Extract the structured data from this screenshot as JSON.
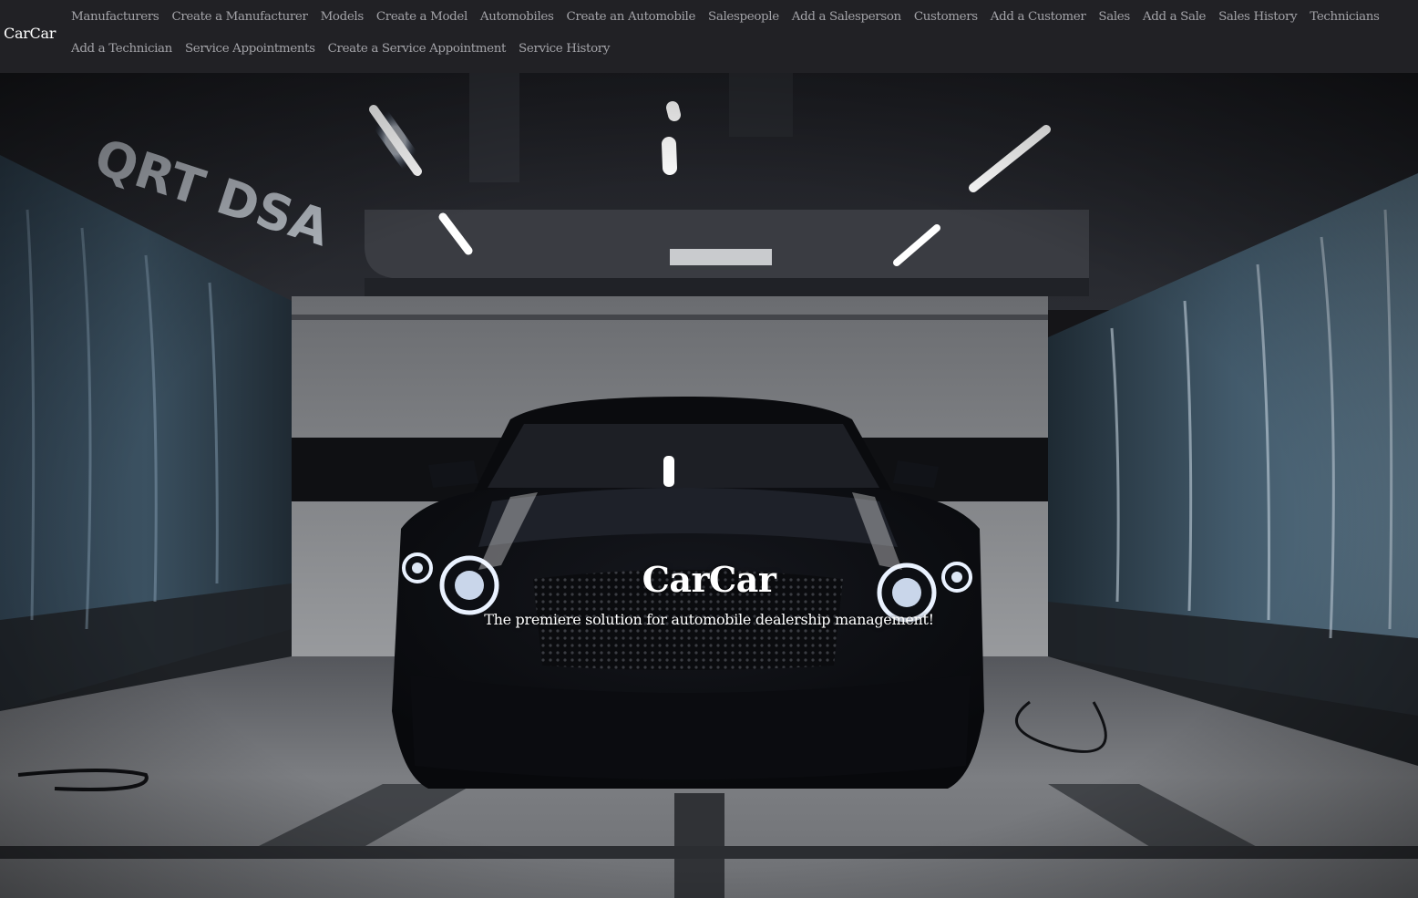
{
  "navbar": {
    "brand": "CarCar",
    "links": [
      "Manufacturers",
      "Create a Manufacturer",
      "Models",
      "Create a Model",
      "Automobiles",
      "Create an Automobile",
      "Salespeople",
      "Add a Salesperson",
      "Customers",
      "Add a Customer",
      "Sales",
      "Add a Sale",
      "Sales History",
      "Technicians",
      "Add a Technician",
      "Service Appointments",
      "Create a Service Appointment",
      "Service History"
    ]
  },
  "hero": {
    "title": "CarCar",
    "subtitle": "The premiere solution for automobile dealership management!"
  },
  "colors": {
    "navbar_bg": "#212125",
    "nav_link": "#a3a3a8",
    "brand": "#ffffff",
    "hero_text": "#ffffff"
  }
}
